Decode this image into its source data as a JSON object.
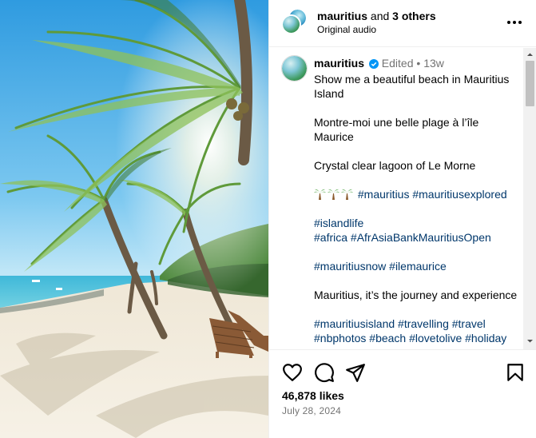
{
  "header": {
    "username": "mauritius",
    "and_text": " and ",
    "others": "3 others",
    "subtitle": "Original audio"
  },
  "caption": {
    "username": "mauritius",
    "edited": "Edited",
    "dot": "•",
    "age": "13w",
    "line1": "Show me a beautiful beach in Mauritius Island",
    "line2": "Montre-moi une belle plage à l’île Maurice",
    "line3": "Crystal clear lagoon of Le Morne",
    "line4_tags": "#mauritius #mauritiusexplored",
    "line5_tag": "#islandlife",
    "line6_tags": "#africa #AfrAsiaBankMauritiusOpen",
    "line7_tags": "#mauritiusnow #ilemaurice",
    "line8": "Mauritius, it’s the journey and experience",
    "line9_tags": "#mauritiusisland #travelling #travel",
    "line10_tags": "#nbphotos #beach #lovetolive #holiday"
  },
  "icons": {
    "more": "more-options-icon",
    "verified": "verified-badge-icon",
    "palm_emoji": "palm-tree-emoji",
    "like": "heart-icon",
    "comment": "comment-icon",
    "share": "send-icon",
    "save": "bookmark-icon"
  },
  "stats": {
    "likes": "46,878 likes",
    "date": "July 28, 2024"
  },
  "colors": {
    "hashtag": "#00376b",
    "verified": "#0095f6",
    "meta": "#737373"
  }
}
